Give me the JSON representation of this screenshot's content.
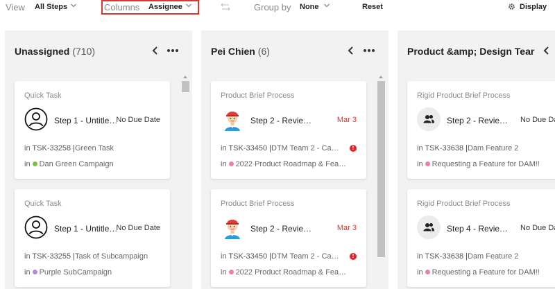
{
  "toolbar": {
    "view_label": "View",
    "view_value": "All Steps",
    "columns_label": "Columns",
    "columns_value": "Assignee",
    "groupby_label": "Group by",
    "groupby_value": "None",
    "reset_label": "Reset",
    "display_label": "Display",
    "highlight_color": "#e0342f"
  },
  "columns": [
    {
      "title": "Unassigned",
      "count": "(710)",
      "cards": [
        {
          "process": "Quick Task",
          "avatar": "person-outline-icon",
          "step": "Step 1 - Untitle…",
          "due": "No Due Date",
          "task_prefix": "in",
          "task_id": "TSK-33258",
          "task_name": "Green Task",
          "project_prefix": "in",
          "project_dot_color": "#7cc242",
          "project": "Dan Green Campaign"
        },
        {
          "process": "Quick Task",
          "avatar": "person-outline-icon",
          "step": "Step 1 - Untitle…",
          "due": "No Due Date",
          "task_prefix": "in",
          "task_id": "TSK-33255",
          "task_name": "Task of Subcampaign",
          "project_prefix": "in",
          "project_dot_color": "#b48ad9",
          "project": "Purple SubCampaign"
        }
      ]
    },
    {
      "title": "Pei Chien",
      "count": "(6)",
      "cards": [
        {
          "process": "Product Brief Process",
          "avatar": "cartoon-person-avatar-icon",
          "step": "Step 2 - Revie…",
          "due": "Mar 3",
          "task_prefix": "in",
          "task_id": "TSK-33450",
          "task_name": "DTM Team 2 - Ca…",
          "warning": "!",
          "project_prefix": "in",
          "project_dot_color": "#f07fa8",
          "project": "2022 Product Roadmap & Fea…"
        },
        {
          "process": "Product Brief Process",
          "avatar": "cartoon-person-avatar-icon",
          "step": "Step 2 - Revie…",
          "due": "Mar 3",
          "task_prefix": "in",
          "task_id": "TSK-33450",
          "task_name": "DTM Team 2 - Ca…",
          "warning": "!",
          "project_prefix": "in",
          "project_dot_color": "#f07fa8",
          "project": "2022 Product Roadmap & Fea…"
        }
      ]
    },
    {
      "title": "Product &amp; Design Tear",
      "count": "",
      "cards": [
        {
          "process": "Rigid Product Brief Process",
          "avatar": "group-icon",
          "step": "Step 2 - Revie…",
          "due": "No Due Date",
          "task_prefix": "in",
          "task_id": "TSK-33638",
          "task_name": "Dam Feature 2",
          "project_prefix": "in",
          "project_dot_color": "#f07fa8",
          "project": "Requesting a Feature for DAM!!"
        },
        {
          "process": "Rigid Product Brief Process",
          "avatar": "group-icon",
          "step": "Step 4 - Revie…",
          "due": "No Due Date",
          "task_prefix": "in",
          "task_id": "TSK-33638",
          "task_name": "Dam Feature 2",
          "project_prefix": "in",
          "project_dot_color": "#f07fa8",
          "project": "Requesting a Feature for DAM!!"
        }
      ]
    }
  ]
}
